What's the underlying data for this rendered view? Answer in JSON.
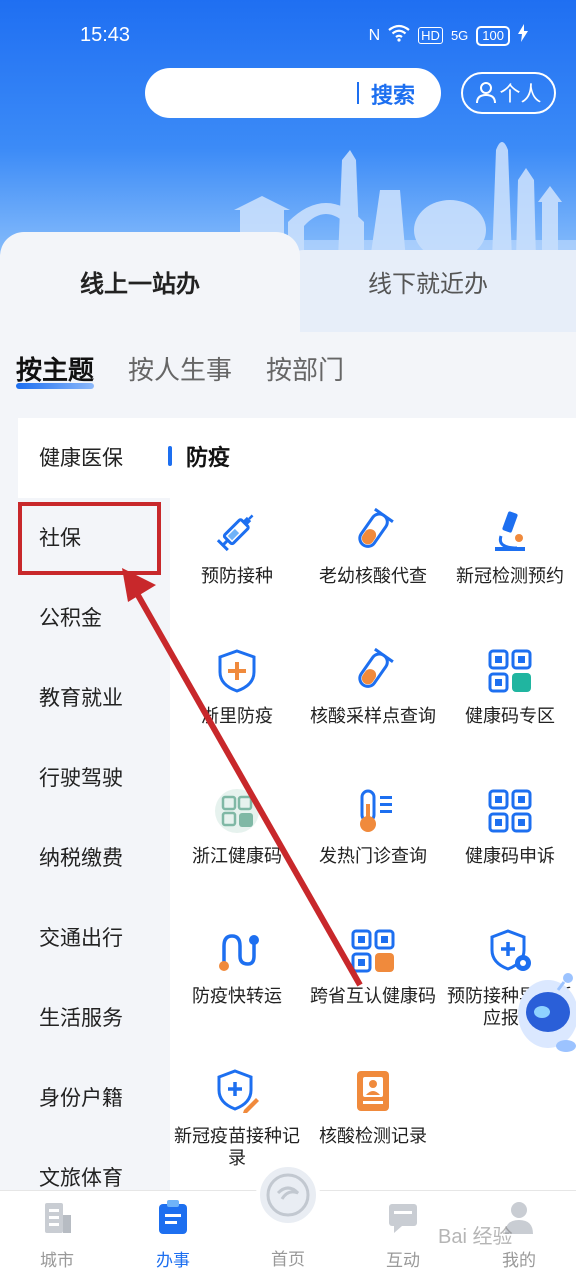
{
  "status": {
    "time": "15:43",
    "nfc": "N",
    "hd": "HD",
    "network": "5G",
    "battery": "100"
  },
  "header": {
    "search_label": "搜索",
    "personal_label": "个人"
  },
  "main_tabs": [
    {
      "label": "线上一站办"
    },
    {
      "label": "线下就近办"
    }
  ],
  "sub_tabs": [
    {
      "label": "按主题"
    },
    {
      "label": "按人生事"
    },
    {
      "label": "按部门"
    }
  ],
  "sidebar": {
    "items": [
      {
        "label": "健康医保"
      },
      {
        "label": "社保"
      },
      {
        "label": "公积金"
      },
      {
        "label": "教育就业"
      },
      {
        "label": "行驶驾驶"
      },
      {
        "label": "纳税缴费"
      },
      {
        "label": "交通出行"
      },
      {
        "label": "生活服务"
      },
      {
        "label": "身份户籍"
      },
      {
        "label": "文旅体育"
      }
    ]
  },
  "section": {
    "title": "防疫"
  },
  "services": [
    {
      "label": "预防接种",
      "icon": "syringe-icon"
    },
    {
      "label": "老幼核酸代查",
      "icon": "test-tube-icon"
    },
    {
      "label": "新冠检测预约",
      "icon": "microscope-icon"
    },
    {
      "label": "浙里防疫",
      "icon": "shield-plus-icon"
    },
    {
      "label": "核酸采样点查询",
      "icon": "test-tube-icon"
    },
    {
      "label": "健康码专区",
      "icon": "qr-code-icon"
    },
    {
      "label": "浙江健康码",
      "icon": "qr-code-icon"
    },
    {
      "label": "发热门诊查询",
      "icon": "thermometer-icon"
    },
    {
      "label": "健康码申诉",
      "icon": "qr-code-icon"
    },
    {
      "label": "防疫快转运",
      "icon": "route-icon"
    },
    {
      "label": "跨省互认健康码",
      "icon": "qr-code-icon"
    },
    {
      "label": "预防接种异常反应报告",
      "icon": "shield-gear-icon"
    },
    {
      "label": "新冠疫苗接种记录",
      "icon": "shield-pen-icon"
    },
    {
      "label": "核酸检测记录",
      "icon": "report-icon"
    }
  ],
  "bottom_nav": [
    {
      "label": "城市"
    },
    {
      "label": "办事"
    },
    {
      "label": "首页"
    },
    {
      "label": "互动"
    },
    {
      "label": "我的"
    }
  ],
  "watermark": "Bai 经验",
  "colors": {
    "primary": "#1d6ff0",
    "highlight": "#c8282b",
    "orange": "#f08a3c"
  }
}
